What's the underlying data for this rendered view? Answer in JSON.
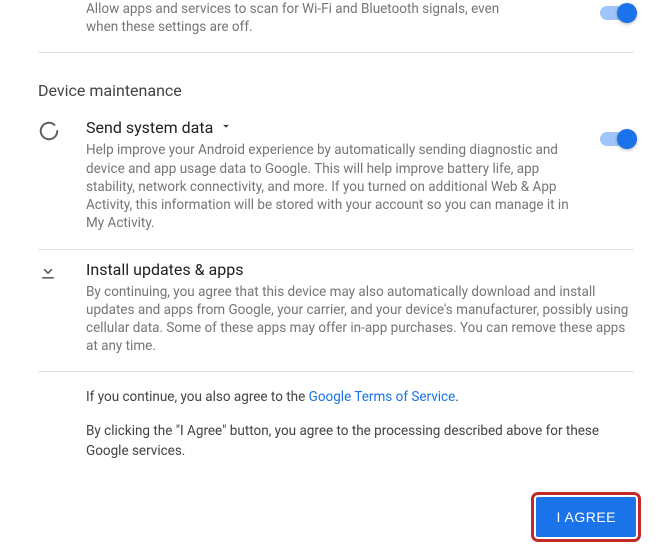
{
  "scanning": {
    "desc": "Allow apps and services to scan for Wi-Fi and Bluetooth signals, even when these settings are off."
  },
  "section_header": "Device maintenance",
  "system_data": {
    "title": "Send system data",
    "desc": "Help improve your Android experience by automatically sending diagnostic and device and app usage data to Google. This will help improve battery life, app stability, network connectivity, and more. If you turned on additional Web & App Activity, this information will be stored with your account so you can manage it in My Activity."
  },
  "install": {
    "title": "Install updates & apps",
    "desc": "By continuing, you agree that this device may also automatically download and install updates and apps from Google, your carrier, and your device's manufacturer, possibly using cellular data. Some of these apps may offer in-app purchases. You can remove these apps at any time."
  },
  "legal": {
    "line1_prefix": "If you continue, you also agree to the ",
    "tos_link": "Google Terms of Service",
    "line1_suffix": ".",
    "line2": "By clicking the \"I Agree\" button, you agree to the processing described above for these Google services."
  },
  "footer": {
    "agree": "I AGREE"
  }
}
